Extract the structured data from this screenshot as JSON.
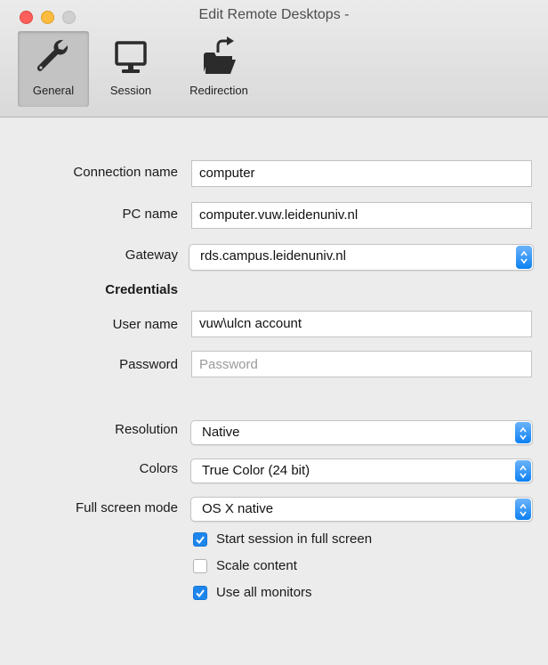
{
  "window": {
    "title": "Edit Remote Desktops -"
  },
  "toolbar": {
    "items": [
      {
        "label": "General",
        "icon": "wrench-icon",
        "selected": true
      },
      {
        "label": "Session",
        "icon": "monitor-icon",
        "selected": false
      },
      {
        "label": "Redirection",
        "icon": "folder-redirect-icon",
        "selected": false
      }
    ]
  },
  "form": {
    "connection_name": {
      "label": "Connection name",
      "value": "computer"
    },
    "pc_name": {
      "label": "PC name",
      "value": "computer.vuw.leidenuniv.nl"
    },
    "gateway": {
      "label": "Gateway",
      "value": "rds.campus.leidenuniv.nl"
    },
    "credentials_heading": "Credentials",
    "user_name": {
      "label": "User name",
      "value": "vuw\\ulcn account"
    },
    "password": {
      "label": "Password",
      "placeholder": "Password",
      "value": ""
    },
    "resolution": {
      "label": "Resolution",
      "value": "Native"
    },
    "colors": {
      "label": "Colors",
      "value": "True Color (24 bit)"
    },
    "full_screen_mode": {
      "label": "Full screen mode",
      "value": "OS X native"
    },
    "checkboxes": [
      {
        "label": "Start session in full screen",
        "checked": true
      },
      {
        "label": "Scale content",
        "checked": false
      },
      {
        "label": "Use all monitors",
        "checked": true
      }
    ]
  },
  "colors": {
    "accent": "#1d86ec",
    "focus_ring": "#6aa6e8",
    "close": "#fc605c",
    "minimize": "#fdbc40"
  }
}
